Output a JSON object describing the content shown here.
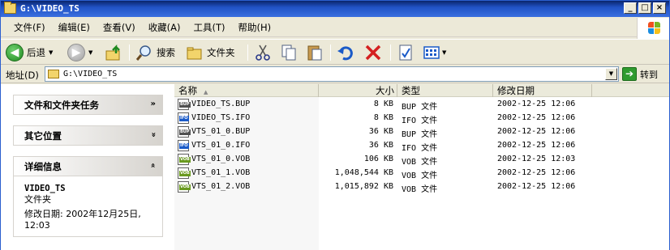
{
  "window": {
    "title": "G:\\VIDEO_TS",
    "buttons": {
      "minimize": "_",
      "maximize": "□",
      "close": "×"
    }
  },
  "menu": [
    "文件(F)",
    "编辑(E)",
    "查看(V)",
    "收藏(A)",
    "工具(T)",
    "帮助(H)"
  ],
  "toolbar": {
    "back_label": "后退",
    "search_label": "搜索",
    "folders_label": "文件夹"
  },
  "address": {
    "label": "地址(D)",
    "value": "G:\\VIDEO_TS",
    "go_label": "转到"
  },
  "tasks": {
    "file_tasks_title": "文件和文件夹任务",
    "other_places_title": "其它位置",
    "details_title": "详细信息",
    "details": {
      "name": "VIDEO_TS",
      "type": "文件夹",
      "modified_line1": "修改日期: 2002年12月25日,",
      "modified_line2": "12:03"
    }
  },
  "columns": {
    "name": "名称",
    "size": "大小",
    "type": "类型",
    "modified": "修改日期"
  },
  "files": [
    {
      "name": "VIDEO_TS.BUP",
      "size": "8 KB",
      "type": "BUP 文件",
      "modified": "2002-12-25 12:06",
      "icon": "bup-file-icon"
    },
    {
      "name": "VIDEO_TS.IFO",
      "size": "8 KB",
      "type": "IFO 文件",
      "modified": "2002-12-25 12:06",
      "icon": "ifo-file-icon"
    },
    {
      "name": "VTS_01_0.BUP",
      "size": "36 KB",
      "type": "BUP 文件",
      "modified": "2002-12-25 12:06",
      "icon": "bup-file-icon"
    },
    {
      "name": "VTS_01_0.IFO",
      "size": "36 KB",
      "type": "IFO 文件",
      "modified": "2002-12-25 12:06",
      "icon": "ifo-file-icon"
    },
    {
      "name": "VTS_01_0.VOB",
      "size": "106 KB",
      "type": "VOB 文件",
      "modified": "2002-12-25 12:03",
      "icon": "vob-file-icon"
    },
    {
      "name": "VTS_01_1.VOB",
      "size": "1,048,544 KB",
      "type": "VOB 文件",
      "modified": "2002-12-25 12:06",
      "icon": "vob-file-icon"
    },
    {
      "name": "VTS_01_2.VOB",
      "size": "1,015,892 KB",
      "type": "VOB 文件",
      "modified": "2002-12-25 12:06",
      "icon": "vob-file-icon"
    }
  ]
}
